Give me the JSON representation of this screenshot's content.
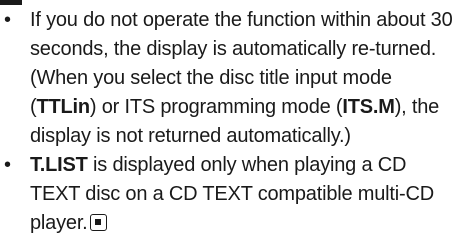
{
  "notes": {
    "item1": {
      "bullet": "•",
      "text": "If you do not operate the function within about 30 seconds, the display is automatically re-turned.",
      "sub": {
        "open": "(When you select the disc title input mode (",
        "mode1": "TTLin",
        "mid": ") or ITS programming mode (",
        "mode2": "ITS.M",
        "close": "), the display is not returned automatically.)"
      }
    },
    "item2": {
      "bullet": "•",
      "term": "T.LIST",
      "text": " is displayed only when playing a CD TEXT disc on a CD TEXT compatible multi-CD player.",
      "end_icon": "end-of-section-icon"
    }
  }
}
